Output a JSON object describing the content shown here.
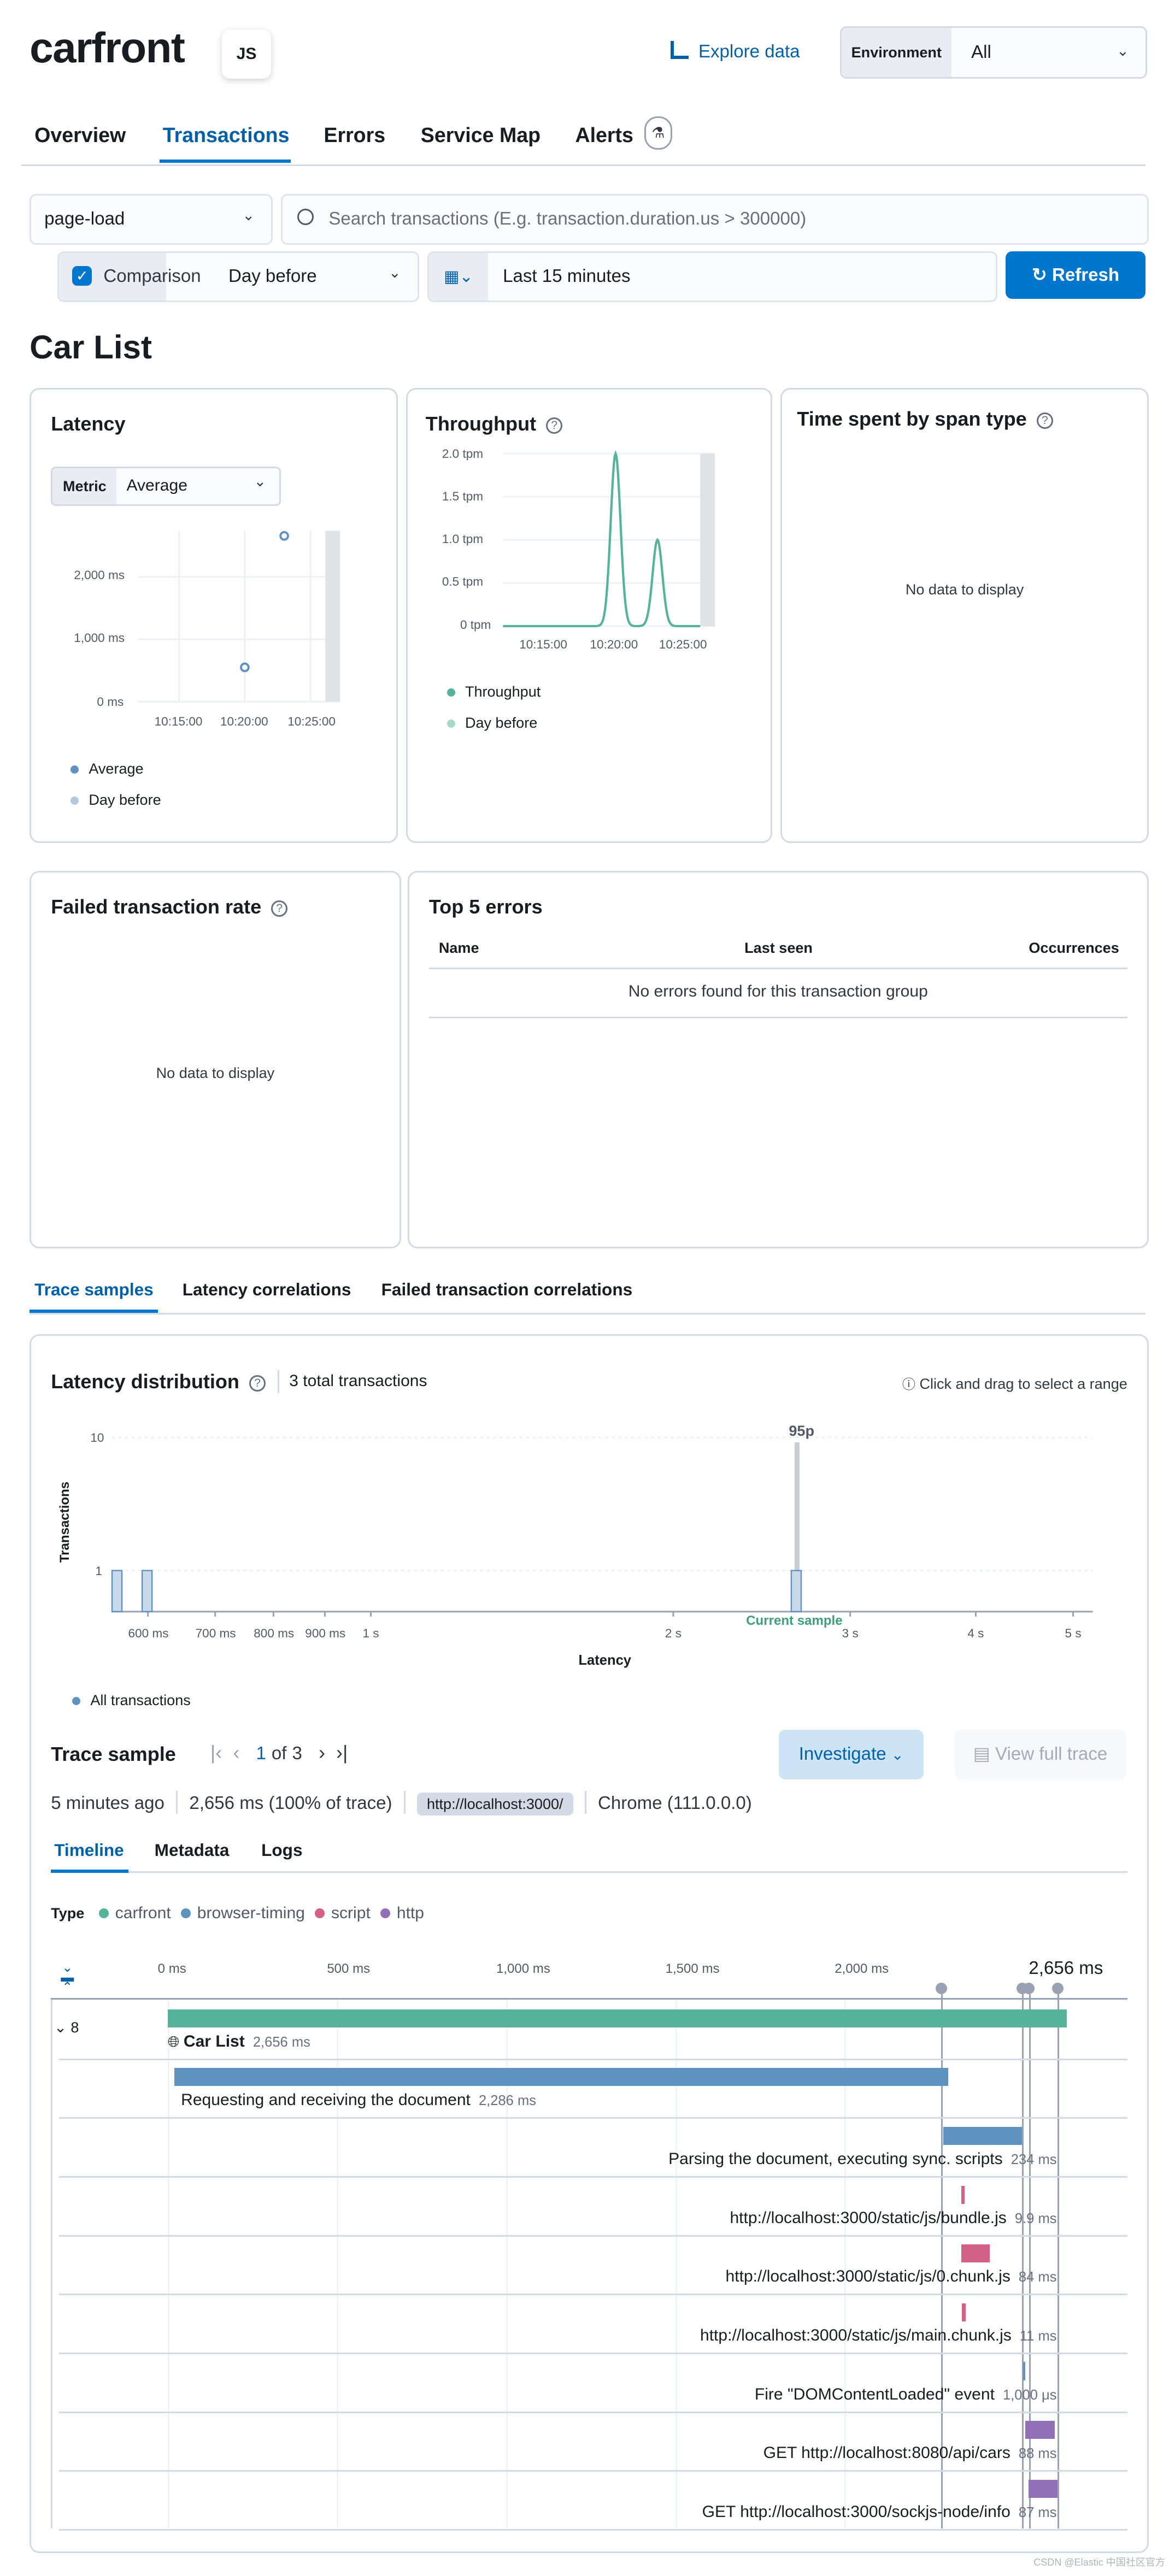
{
  "header": {
    "service": "carfront",
    "agent_badge": "JS",
    "explore_data": "Explore data",
    "environment_label": "Environment",
    "environment_value": "All"
  },
  "tabs": [
    {
      "label": "Overview"
    },
    {
      "label": "Transactions",
      "active": true
    },
    {
      "label": "Errors"
    },
    {
      "label": "Service Map"
    },
    {
      "label": "Alerts"
    }
  ],
  "filters": {
    "transaction_type": "page-load",
    "search_placeholder": "Search transactions (E.g. transaction.duration.us > 300000)",
    "comparison_label": "Comparison",
    "comparison_checked": true,
    "comparison_value": "Day before",
    "time_range": "Last 15 minutes",
    "refresh": "Refresh"
  },
  "page_title": "Car List",
  "latency": {
    "title": "Latency",
    "metric_label": "Metric",
    "metric_value": "Average",
    "y_ticks": [
      "2,000 ms",
      "1,000 ms",
      "0 ms"
    ],
    "x_ticks": [
      "10:15:00",
      "10:20:00",
      "10:25:00"
    ],
    "legend": [
      "Average",
      "Day before"
    ],
    "chart_data": {
      "type": "scatter",
      "y_unit": "ms",
      "ylim": [
        0,
        2800
      ],
      "series": [
        {
          "name": "Average",
          "points": [
            {
              "x": "10:20:00",
              "y": 550
            },
            {
              "x": "10:23:00",
              "y": 2656
            }
          ]
        },
        {
          "name": "Day before",
          "points": []
        }
      ]
    }
  },
  "throughput": {
    "title": "Throughput",
    "y_ticks": [
      "2.0 tpm",
      "1.5 tpm",
      "1.0 tpm",
      "0.5 tpm",
      "0 tpm"
    ],
    "x_ticks": [
      "10:15:00",
      "10:20:00",
      "10:25:00"
    ],
    "legend": [
      "Throughput",
      "Day before"
    ],
    "chart_data": {
      "type": "line",
      "y_unit": "tpm",
      "ylim": [
        0,
        2
      ],
      "series": [
        {
          "name": "Throughput",
          "peaks": [
            {
              "x": "10:20:00",
              "y": 2.0
            },
            {
              "x": "10:23:00",
              "y": 1.0
            }
          ]
        }
      ]
    }
  },
  "span_type": {
    "title": "Time spent by span type",
    "empty": "No data to display"
  },
  "failed_rate": {
    "title": "Failed transaction rate",
    "empty": "No data to display"
  },
  "top_errors": {
    "title": "Top 5 errors",
    "columns": [
      "Name",
      "Last seen",
      "Occurrences"
    ],
    "empty": "No errors found for this transaction group"
  },
  "section_tabs": [
    {
      "label": "Trace samples",
      "active": true
    },
    {
      "label": "Latency correlations"
    },
    {
      "label": "Failed transaction correlations"
    }
  ],
  "distribution": {
    "title": "Latency distribution",
    "total": "3 total transactions",
    "hint": "Click and drag to select a range",
    "y_label": "Transactions",
    "x_label": "Latency",
    "percentile_label": "95p",
    "current_sample": "Current sample",
    "legend": "All transactions",
    "y_ticks": [
      "10",
      "1"
    ],
    "x_ticks": [
      "600 ms",
      "700 ms",
      "800 ms",
      "900 ms",
      "1 s",
      "2 s",
      "3 s",
      "4 s",
      "5 s"
    ],
    "chart_data": {
      "type": "bar",
      "xscale": "log",
      "yscale": "log",
      "bins": [
        {
          "latency_ms": 560,
          "count": 1
        },
        {
          "latency_ms": 600,
          "count": 1
        },
        {
          "latency_ms": 2656,
          "count": 1
        }
      ],
      "percentile_95_ms": 2656
    }
  },
  "trace_sample": {
    "title": "Trace sample",
    "page": "1",
    "of": "of",
    "total": "3",
    "investigate": "Investigate",
    "view_full_trace": "View full trace",
    "age": "5 minutes ago",
    "duration": "2,656 ms (100% of trace)",
    "url": "http://localhost:3000/",
    "agent": "Chrome (111.0.0.0)",
    "tabs": [
      "Timeline",
      "Metadata",
      "Logs"
    ],
    "type_label": "Type",
    "types": [
      {
        "name": "carfront",
        "color": "#54b399"
      },
      {
        "name": "browser-timing",
        "color": "#6092c0"
      },
      {
        "name": "script",
        "color": "#d36086"
      },
      {
        "name": "http",
        "color": "#9170b8"
      }
    ],
    "axis": [
      "0 ms",
      "500 ms",
      "1,000 ms",
      "1,500 ms",
      "2,000 ms"
    ],
    "total_label": "2,656 ms",
    "collapse_count": "8",
    "spans": [
      {
        "name": "Car List",
        "duration": "2,656 ms",
        "type": "carfront",
        "start_ms": 0,
        "duration_ms": 2656
      },
      {
        "name": "Requesting and receiving the document",
        "duration": "2,286 ms",
        "type": "browser-timing",
        "start_ms": 20,
        "duration_ms": 2286
      },
      {
        "name": "Parsing the document, executing sync. scripts",
        "duration": "234 ms",
        "type": "browser-timing",
        "start_ms": 2291,
        "duration_ms": 234
      },
      {
        "name": "http://localhost:3000/static/js/bundle.js",
        "duration": "9.9 ms",
        "type": "script",
        "start_ms": 2345,
        "duration_ms": 9.9
      },
      {
        "name": "http://localhost:3000/static/js/0.chunk.js",
        "duration": "84 ms",
        "type": "script",
        "start_ms": 2345,
        "duration_ms": 84
      },
      {
        "name": "http://localhost:3000/static/js/main.chunk.js",
        "duration": "11 ms",
        "type": "script",
        "start_ms": 2347,
        "duration_ms": 11
      },
      {
        "name": "Fire \"DOMContentLoaded\" event",
        "duration": "1,000 μs",
        "type": "browser-timing",
        "start_ms": 2527,
        "duration_ms": 1
      },
      {
        "name": "GET http://localhost:8080/api/cars",
        "duration": "88 ms",
        "type": "http",
        "start_ms": 2534,
        "duration_ms": 88
      },
      {
        "name": "GET http://localhost:3000/sockjs-node/info",
        "duration": "87 ms",
        "type": "http",
        "start_ms": 2543,
        "duration_ms": 87
      }
    ],
    "marks_ms": [
      2286,
      2525,
      2545,
      2630
    ]
  },
  "watermark": "CSDN @Elastic 中国社区官方"
}
